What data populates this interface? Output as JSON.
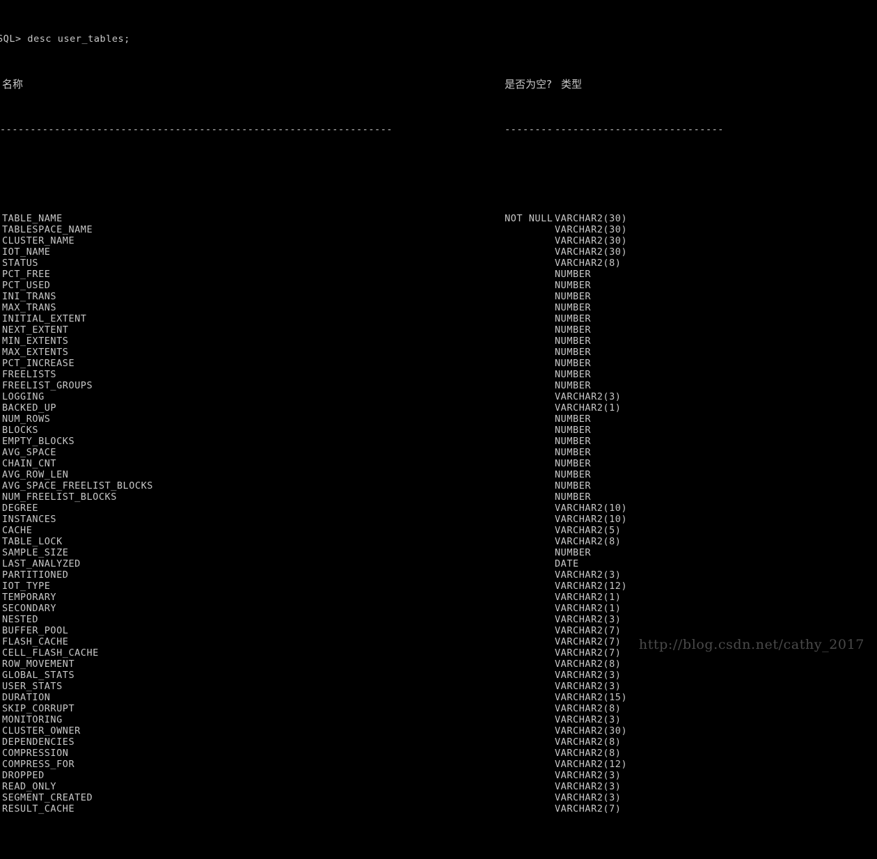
{
  "terminal": {
    "prompt_line": "SQL> desc user_tables;",
    "rule_name": "-----------------------------------------------------------------",
    "rule_null": "--------",
    "rule_type": "----------------------------",
    "colors": {
      "background": "#000000",
      "foreground": "#c8c8c8",
      "watermark": "#4a4a4a"
    }
  },
  "header": {
    "name_label": "名称",
    "null_label": "是否为空?",
    "type_label": "类型"
  },
  "watermark": {
    "text": "http://blog.csdn.net/cathy_2017"
  },
  "rows": [
    {
      "name": "TABLE_NAME",
      "null": "NOT NULL",
      "type": "VARCHAR2(30)"
    },
    {
      "name": "TABLESPACE_NAME",
      "null": "",
      "type": "VARCHAR2(30)"
    },
    {
      "name": "CLUSTER_NAME",
      "null": "",
      "type": "VARCHAR2(30)"
    },
    {
      "name": "IOT_NAME",
      "null": "",
      "type": "VARCHAR2(30)"
    },
    {
      "name": "STATUS",
      "null": "",
      "type": "VARCHAR2(8)"
    },
    {
      "name": "PCT_FREE",
      "null": "",
      "type": "NUMBER"
    },
    {
      "name": "PCT_USED",
      "null": "",
      "type": "NUMBER"
    },
    {
      "name": "INI_TRANS",
      "null": "",
      "type": "NUMBER"
    },
    {
      "name": "MAX_TRANS",
      "null": "",
      "type": "NUMBER"
    },
    {
      "name": "INITIAL_EXTENT",
      "null": "",
      "type": "NUMBER"
    },
    {
      "name": "NEXT_EXTENT",
      "null": "",
      "type": "NUMBER"
    },
    {
      "name": "MIN_EXTENTS",
      "null": "",
      "type": "NUMBER"
    },
    {
      "name": "MAX_EXTENTS",
      "null": "",
      "type": "NUMBER"
    },
    {
      "name": "PCT_INCREASE",
      "null": "",
      "type": "NUMBER"
    },
    {
      "name": "FREELISTS",
      "null": "",
      "type": "NUMBER"
    },
    {
      "name": "FREELIST_GROUPS",
      "null": "",
      "type": "NUMBER"
    },
    {
      "name": "LOGGING",
      "null": "",
      "type": "VARCHAR2(3)"
    },
    {
      "name": "BACKED_UP",
      "null": "",
      "type": "VARCHAR2(1)"
    },
    {
      "name": "NUM_ROWS",
      "null": "",
      "type": "NUMBER"
    },
    {
      "name": "BLOCKS",
      "null": "",
      "type": "NUMBER"
    },
    {
      "name": "EMPTY_BLOCKS",
      "null": "",
      "type": "NUMBER"
    },
    {
      "name": "AVG_SPACE",
      "null": "",
      "type": "NUMBER"
    },
    {
      "name": "CHAIN_CNT",
      "null": "",
      "type": "NUMBER"
    },
    {
      "name": "AVG_ROW_LEN",
      "null": "",
      "type": "NUMBER"
    },
    {
      "name": "AVG_SPACE_FREELIST_BLOCKS",
      "null": "",
      "type": "NUMBER"
    },
    {
      "name": "NUM_FREELIST_BLOCKS",
      "null": "",
      "type": "NUMBER"
    },
    {
      "name": "DEGREE",
      "null": "",
      "type": "VARCHAR2(10)"
    },
    {
      "name": "INSTANCES",
      "null": "",
      "type": "VARCHAR2(10)"
    },
    {
      "name": "CACHE",
      "null": "",
      "type": "VARCHAR2(5)"
    },
    {
      "name": "TABLE_LOCK",
      "null": "",
      "type": "VARCHAR2(8)"
    },
    {
      "name": "SAMPLE_SIZE",
      "null": "",
      "type": "NUMBER"
    },
    {
      "name": "LAST_ANALYZED",
      "null": "",
      "type": "DATE"
    },
    {
      "name": "PARTITIONED",
      "null": "",
      "type": "VARCHAR2(3)"
    },
    {
      "name": "IOT_TYPE",
      "null": "",
      "type": "VARCHAR2(12)"
    },
    {
      "name": "TEMPORARY",
      "null": "",
      "type": "VARCHAR2(1)"
    },
    {
      "name": "SECONDARY",
      "null": "",
      "type": "VARCHAR2(1)"
    },
    {
      "name": "NESTED",
      "null": "",
      "type": "VARCHAR2(3)"
    },
    {
      "name": "BUFFER_POOL",
      "null": "",
      "type": "VARCHAR2(7)"
    },
    {
      "name": "FLASH_CACHE",
      "null": "",
      "type": "VARCHAR2(7)"
    },
    {
      "name": "CELL_FLASH_CACHE",
      "null": "",
      "type": "VARCHAR2(7)"
    },
    {
      "name": "ROW_MOVEMENT",
      "null": "",
      "type": "VARCHAR2(8)"
    },
    {
      "name": "GLOBAL_STATS",
      "null": "",
      "type": "VARCHAR2(3)"
    },
    {
      "name": "USER_STATS",
      "null": "",
      "type": "VARCHAR2(3)"
    },
    {
      "name": "DURATION",
      "null": "",
      "type": "VARCHAR2(15)"
    },
    {
      "name": "SKIP_CORRUPT",
      "null": "",
      "type": "VARCHAR2(8)"
    },
    {
      "name": "MONITORING",
      "null": "",
      "type": "VARCHAR2(3)"
    },
    {
      "name": "CLUSTER_OWNER",
      "null": "",
      "type": "VARCHAR2(30)"
    },
    {
      "name": "DEPENDENCIES",
      "null": "",
      "type": "VARCHAR2(8)"
    },
    {
      "name": "COMPRESSION",
      "null": "",
      "type": "VARCHAR2(8)"
    },
    {
      "name": "COMPRESS_FOR",
      "null": "",
      "type": "VARCHAR2(12)"
    },
    {
      "name": "DROPPED",
      "null": "",
      "type": "VARCHAR2(3)"
    },
    {
      "name": "READ_ONLY",
      "null": "",
      "type": "VARCHAR2(3)"
    },
    {
      "name": "SEGMENT_CREATED",
      "null": "",
      "type": "VARCHAR2(3)"
    },
    {
      "name": "RESULT_CACHE",
      "null": "",
      "type": "VARCHAR2(7)"
    }
  ]
}
